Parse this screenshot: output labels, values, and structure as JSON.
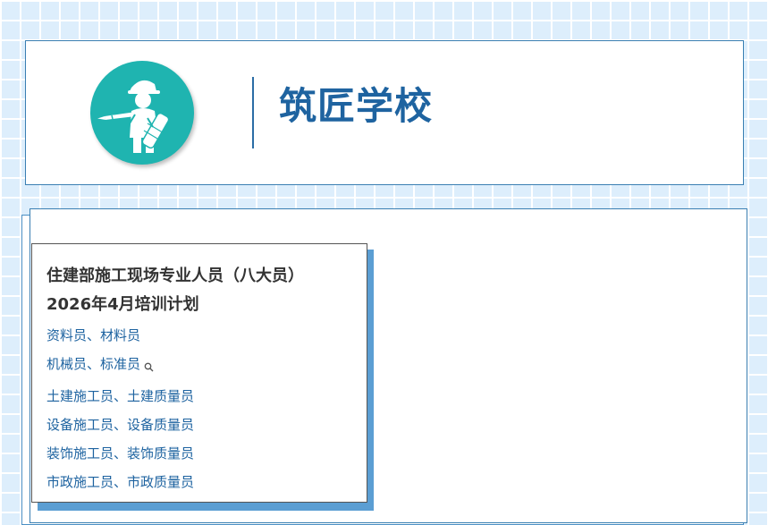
{
  "header": {
    "school_name": "筑匠学校",
    "logo_icon": "worker-with-pencil-and-blueprint-icon",
    "logo_color": "#1fb4b0",
    "brand_color": "#1e63a0"
  },
  "notice": {
    "title_line1": "住建部施工现场专业人员（八大员）",
    "title_line2": "2026年4月培训计划",
    "links": [
      {
        "label": "资料员、材料员"
      },
      {
        "label": "机械员、标准员"
      },
      {
        "label": "土建施工员、土建质量员"
      },
      {
        "label": "设备施工员、设备质量员"
      },
      {
        "label": "装饰施工员、装饰质量员"
      },
      {
        "label": "市政施工员、市政质量员"
      }
    ],
    "search_icon": "magnifier-icon"
  }
}
